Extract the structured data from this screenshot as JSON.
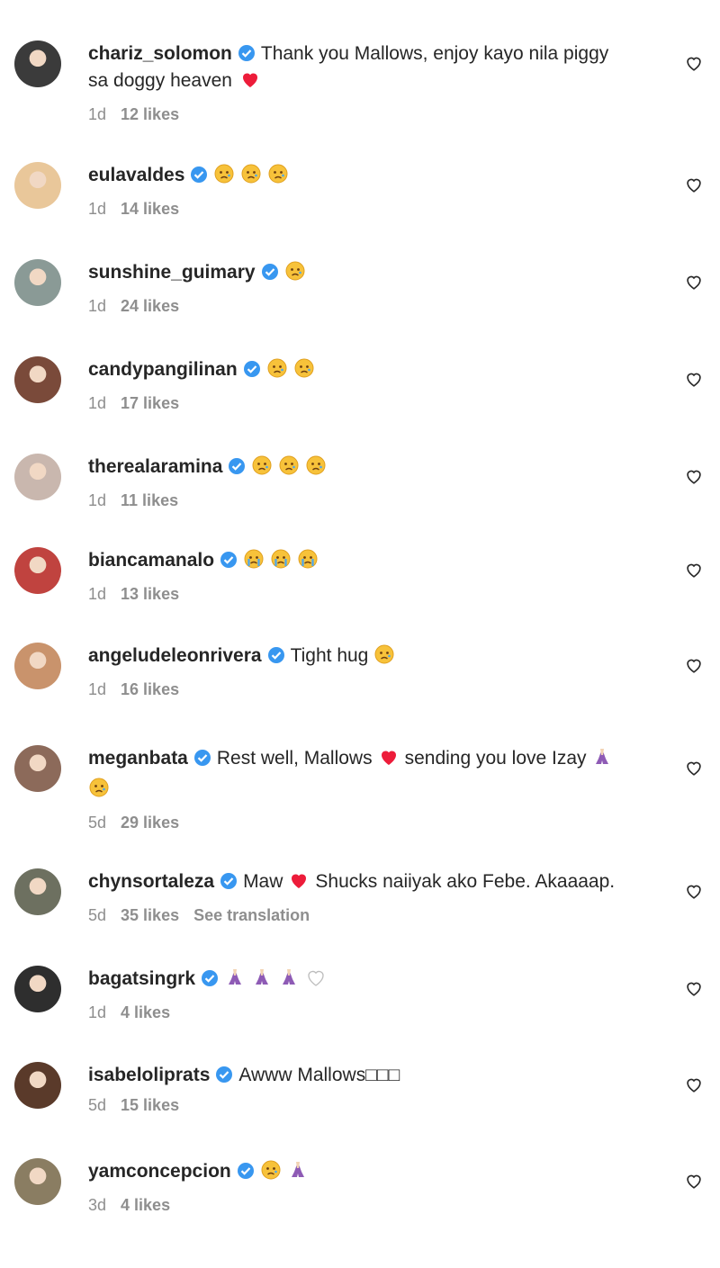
{
  "colors": {
    "username": "#262626",
    "meta": "#8e8e8e",
    "verified": "#3897f0",
    "red_heart": "#ed1c3a"
  },
  "comments": [
    {
      "user": "chariz_solomon",
      "text": "Thank you Mallows, enjoy kayo nila piggy",
      "text2": "sa doggy heaven",
      "emojis": [],
      "emojis2": [
        "red-heart"
      ],
      "time": "1d",
      "likes": "12 likes",
      "avatar": "#3b3b3b"
    },
    {
      "user": "eulavaldes",
      "text": "",
      "emojis": [
        "sad",
        "sad",
        "sad"
      ],
      "time": "1d",
      "likes": "14 likes",
      "avatar": "#e9c79a"
    },
    {
      "user": "sunshine_guimary",
      "text": "",
      "emojis": [
        "sad"
      ],
      "time": "1d",
      "likes": "24 likes",
      "avatar": "#8a9a96"
    },
    {
      "user": "candypangilinan",
      "text": "",
      "emojis": [
        "sad",
        "sad"
      ],
      "time": "1d",
      "likes": "17 likes",
      "avatar": "#7a4a3a"
    },
    {
      "user": "therealaramina",
      "text": "",
      "emojis": [
        "sad",
        "sad",
        "sad"
      ],
      "time": "1d",
      "likes": "11 likes",
      "avatar": "#c9b7ae"
    },
    {
      "user": "biancamanalo",
      "text": "",
      "emojis": [
        "crying",
        "crying",
        "crying"
      ],
      "time": "1d",
      "likes": "13 likes",
      "avatar": "#c0433f"
    },
    {
      "user": "angeludeleonrivera",
      "text": "Tight hug",
      "emojis": [
        "sad"
      ],
      "time": "1d",
      "likes": "16 likes",
      "avatar": "#c9936c"
    },
    {
      "user": "meganbata",
      "text": "Rest well, Mallows",
      "emojis": [
        "red-heart"
      ],
      "text_after": "sending you love Izay",
      "emojis_after": [
        "praying"
      ],
      "emojis2": [
        "sad"
      ],
      "time": "5d",
      "likes": "29 likes",
      "avatar": "#8c6a5a"
    },
    {
      "user": "chynsortaleza",
      "text": "Maw",
      "emojis": [
        "red-heart"
      ],
      "text_after": "Shucks naiiyak ako Febe. Akaaaap.",
      "time": "5d",
      "likes": "35 likes",
      "see_translation": "See translation",
      "avatar": "#6d7060"
    },
    {
      "user": "bagatsingrk",
      "text": "",
      "emojis": [
        "praying",
        "praying",
        "praying",
        "white-heart"
      ],
      "time": "1d",
      "likes": "4 likes",
      "avatar": "#2e2e2e"
    },
    {
      "user": "isabeloliprats",
      "text": "Awww Mallows□□□",
      "emojis": [],
      "time": "5d",
      "likes": "15 likes",
      "avatar": "#5a3a2a"
    },
    {
      "user": "yamconcepcion",
      "text": "",
      "emojis": [
        "sad",
        "praying"
      ],
      "time": "3d",
      "likes": "4 likes",
      "avatar": "#8a7d62"
    }
  ]
}
